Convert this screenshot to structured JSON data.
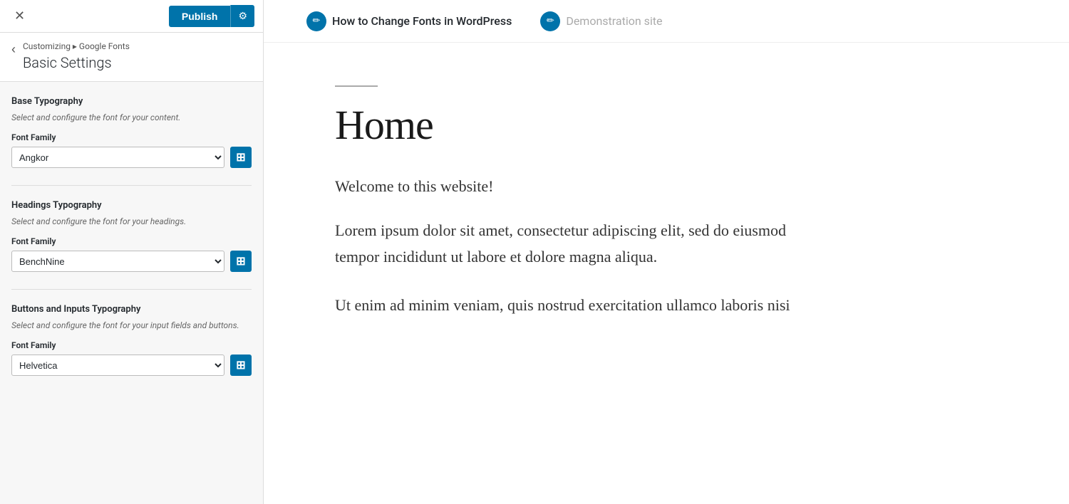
{
  "header": {
    "close_label": "✕",
    "publish_label": "Publish",
    "settings_label": "⚙"
  },
  "breadcrumb": {
    "back_label": "‹",
    "nav_text": "Customizing ▸ Google Fonts",
    "title": "Basic Settings"
  },
  "sections": [
    {
      "id": "base-typography",
      "title": "Base Typography",
      "desc": "Select and configure the font for your content.",
      "field_label": "Font Family",
      "font_value": "Angkor"
    },
    {
      "id": "headings-typography",
      "title": "Headings Typography",
      "desc": "Select and configure the font for your headings.",
      "field_label": "Font Family",
      "font_value": "BenchNine"
    },
    {
      "id": "buttons-inputs-typography",
      "title": "Buttons and Inputs Typography",
      "desc": "Select and configure the font for your input fields and buttons.",
      "field_label": "Font Family",
      "font_value": "Helvetica"
    }
  ],
  "preview": {
    "nav_link_1_text": "How to Change Fonts in WordPress",
    "nav_link_2_text": "Demonstration site",
    "divider": true,
    "home_title": "Home",
    "welcome_text": "Welcome to this website!",
    "lorem_text": "Lorem ipsum dolor sit amet, consectetur adipiscing elit, sed do eiusmod tempor incididunt ut labore et dolore magna aliqua.",
    "ut_text": "Ut enim ad minim veniam, quis nostrud exercitation ullamco laboris nisi"
  },
  "colors": {
    "accent": "#0073aa",
    "text_dark": "#23282d",
    "text_muted": "#666",
    "sidebar_bg": "#f7f7f7"
  }
}
